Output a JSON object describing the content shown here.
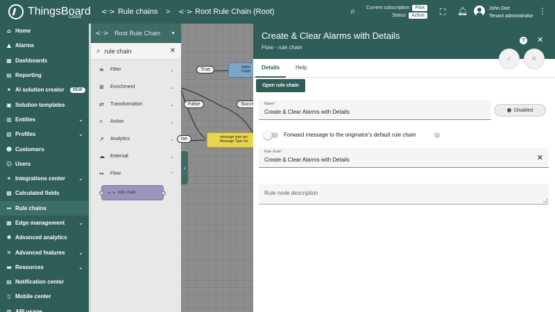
{
  "app": {
    "name": "ThingsBoard",
    "sub": "Cloud"
  },
  "breadcrumb": {
    "first": "Rule chains",
    "second": "Root Rule Chain (Root)"
  },
  "header": {
    "subscription_label": "Current subscription",
    "subscription_value": "Pilot",
    "status_label": "Status",
    "status_value": "Active",
    "user_name": "John Doe",
    "user_role": "Tenant administrator"
  },
  "sidebar": {
    "items": [
      {
        "label": "Home",
        "icon": "home-icon",
        "glyph": "⌂",
        "chevron": false
      },
      {
        "label": "Alarms",
        "icon": "alarm-icon",
        "glyph": "▲",
        "chevron": false
      },
      {
        "label": "Dashboards",
        "icon": "dashboard-icon",
        "glyph": "▦",
        "chevron": false
      },
      {
        "label": "Reporting",
        "icon": "report-icon",
        "glyph": "▤",
        "chevron": false
      },
      {
        "label": "AI solution creator",
        "icon": "ai-icon",
        "glyph": "✦",
        "chevron": false,
        "badge": "NEW"
      },
      {
        "label": "Solution templates",
        "icon": "template-icon",
        "glyph": "▣",
        "chevron": false
      },
      {
        "label": "Entities",
        "icon": "entities-icon",
        "glyph": "▥",
        "chevron": true
      },
      {
        "label": "Profiles",
        "icon": "profiles-icon",
        "glyph": "▧",
        "chevron": true
      },
      {
        "label": "Customers",
        "icon": "customers-icon",
        "glyph": "☻",
        "chevron": false
      },
      {
        "label": "Users",
        "icon": "users-icon",
        "glyph": "☺",
        "chevron": false
      },
      {
        "label": "Integrations center",
        "icon": "integrations-icon",
        "glyph": "⚭",
        "chevron": true
      },
      {
        "label": "Calculated fields",
        "icon": "calc-icon",
        "glyph": "▩",
        "chevron": false
      },
      {
        "label": "Rule chains",
        "icon": "rulechain-icon",
        "glyph": "↔",
        "chevron": false,
        "active": true
      },
      {
        "label": "Edge management",
        "icon": "edge-icon",
        "glyph": "▦",
        "chevron": true
      },
      {
        "label": "Advanced analytics",
        "icon": "analytics-icon",
        "glyph": "✺",
        "chevron": false
      },
      {
        "label": "Advanced features",
        "icon": "features-icon",
        "glyph": "✕",
        "chevron": true
      },
      {
        "label": "Resources",
        "icon": "resources-icon",
        "glyph": "▬",
        "chevron": true
      },
      {
        "label": "Notification center",
        "icon": "notification-icon",
        "glyph": "▤",
        "chevron": false
      },
      {
        "label": "Mobile center",
        "icon": "mobile-icon",
        "glyph": "▯",
        "chevron": false
      },
      {
        "label": "API usage",
        "icon": "api-icon",
        "glyph": "▥",
        "chevron": false
      }
    ]
  },
  "palette": {
    "title": "Root Rule Chain",
    "search_value": "rule chain",
    "categories": [
      {
        "label": "Filter",
        "icon": "filter-icon",
        "glyph": "≡",
        "chevron": "⌄"
      },
      {
        "label": "Enrichment",
        "icon": "enrichment-icon",
        "glyph": "⊞",
        "chevron": "⌄"
      },
      {
        "label": "Transformation",
        "icon": "transformation-icon",
        "glyph": "⇄",
        "chevron": "⌄"
      },
      {
        "label": "Action",
        "icon": "action-icon",
        "glyph": "⚡",
        "chevron": "⌄"
      },
      {
        "label": "Analytics",
        "icon": "analytics-icon",
        "glyph": "↗",
        "chevron": "⌄"
      },
      {
        "label": "External",
        "icon": "external-icon",
        "glyph": "☁",
        "chevron": "⌄"
      },
      {
        "label": "Flow",
        "icon": "flow-icon",
        "glyph": "↔",
        "chevron": "⌃"
      }
    ],
    "flow_node": "rule chain"
  },
  "canvas": {
    "label_true": "True",
    "label_false": "False",
    "label_success": "Succes",
    "label_ise": "ise",
    "node_dup_type": "duplic",
    "node_dup_name": "Duplic",
    "node_switch_type": "message type swi",
    "node_switch_name": "Message Type Sw"
  },
  "dialog": {
    "title": "Create & Clear Alarms with Details",
    "subtitle": "Flow - rule chain",
    "tabs": [
      "Details",
      "Help"
    ],
    "open_button": "Open rule chain",
    "name_label": "Name*",
    "name_value": "Create & Clear Alarms with Details",
    "disabled_label": "Disabled",
    "forward_label": "Forward message to the originator's default rule chain",
    "rulechain_label": "Rule chain*",
    "rulechain_value": "Create & Clear Alarms with Details",
    "description_placeholder": "Rule node description"
  },
  "colors": {
    "primary": "#2f5d57",
    "canvas": "#8d8d8d",
    "node_flow": "#9e93bd",
    "node_switch": "#e8d44e",
    "node_dup": "#7ba6c9"
  }
}
